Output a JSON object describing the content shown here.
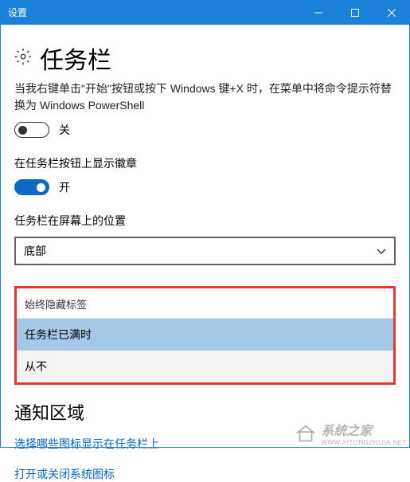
{
  "titlebar": {
    "title": "设置"
  },
  "header": {
    "title": "任务栏"
  },
  "setting1": {
    "desc": "当我右键单击\"开始\"按钮或按下 Windows 键+X 时，在菜单中将命令提示符替换为 Windows PowerShell",
    "state": "关"
  },
  "setting2": {
    "label": "在任务栏按钮上显示徽章",
    "state": "开"
  },
  "position": {
    "label": "任务栏在屏幕上的位置",
    "value": "底部"
  },
  "hide_labels": {
    "header": "始终隐藏标签",
    "options": [
      "任务栏已满时",
      "从不"
    ]
  },
  "notification": {
    "title": "通知区域",
    "link1": "选择哪些图标显示在任务栏上",
    "link2": "打开或关闭系统图标"
  },
  "watermark": {
    "text": "系统之家",
    "url": "WWW.XITONGZHIJIA.NET"
  }
}
